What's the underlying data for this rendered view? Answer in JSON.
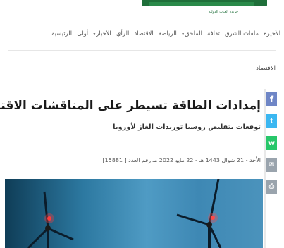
{
  "header": {
    "logo_subtitle": "جريدة العرب الدولية",
    "brand_color": "#1f6f3a"
  },
  "nav": {
    "items": [
      {
        "label": "الرئيسية",
        "dropdown": false
      },
      {
        "label": "أولى",
        "dropdown": false
      },
      {
        "label": "الأخبار",
        "dropdown": true
      },
      {
        "label": "الرأي",
        "dropdown": false
      },
      {
        "label": "الاقتصاد",
        "dropdown": false
      },
      {
        "label": "الرياضة",
        "dropdown": false
      },
      {
        "label": "الملحق",
        "dropdown": true
      },
      {
        "label": "ثقافة",
        "dropdown": false
      },
      {
        "label": "ملفات الشرق",
        "dropdown": false
      },
      {
        "label": "الأخيرة",
        "dropdown": false
      }
    ]
  },
  "breadcrumb": "الاقتصاد",
  "article": {
    "title": "إمدادات الطاقة تسيطر على المناقشات الاقتصادية في ألمانيا",
    "subtitle": "توقعات بتقليص روسيا توريدات الغاز لأوروبا",
    "meta": "الأحد - 21 شوال 1443 هـ - 22 مايو 2022 مـ رقم العدد [ 15881]"
  },
  "share": {
    "facebook": "f",
    "twitter": "t",
    "whatsapp": "w",
    "email": "✉",
    "print": "⎙",
    "colors": {
      "facebook": "#6f86c6",
      "twitter": "#3bb7f1",
      "whatsapp": "#28c76a",
      "email": "#9aa4ad",
      "print": "#9aa4ad"
    }
  }
}
